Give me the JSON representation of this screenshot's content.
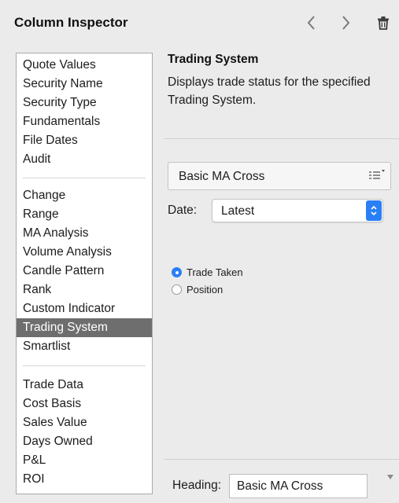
{
  "header": {
    "title": "Column Inspector",
    "icons": [
      "chevron-left-icon",
      "chevron-right-icon",
      "trash-icon"
    ]
  },
  "columns_list": {
    "groups": [
      [
        "Quote Values",
        "Security Name",
        "Security Type",
        "Fundamentals",
        "File Dates",
        "Audit"
      ],
      [
        "Change",
        "Range",
        "MA Analysis",
        "Volume Analysis",
        "Candle Pattern",
        "Rank",
        "Custom Indicator",
        "Trading System",
        "Smartlist"
      ],
      [
        "Trade Data",
        "Cost Basis",
        "Sales Value",
        "Days Owned",
        "P&L",
        "ROI"
      ]
    ],
    "selected": "Trading System"
  },
  "detail": {
    "title": "Trading System",
    "description": "Displays trade status for the specified Trading System.",
    "system_select": {
      "value": "Basic MA Cross"
    },
    "date": {
      "label": "Date:",
      "value": "Latest"
    },
    "radios": [
      {
        "label": "Trade Taken",
        "checked": true
      },
      {
        "label": "Position",
        "checked": false
      }
    ],
    "heading": {
      "label": "Heading:",
      "value": "Basic MA Cross"
    }
  },
  "colors": {
    "accent": "#2a7ff6",
    "selection": "#6e6e6e",
    "background": "#ebebeb"
  }
}
